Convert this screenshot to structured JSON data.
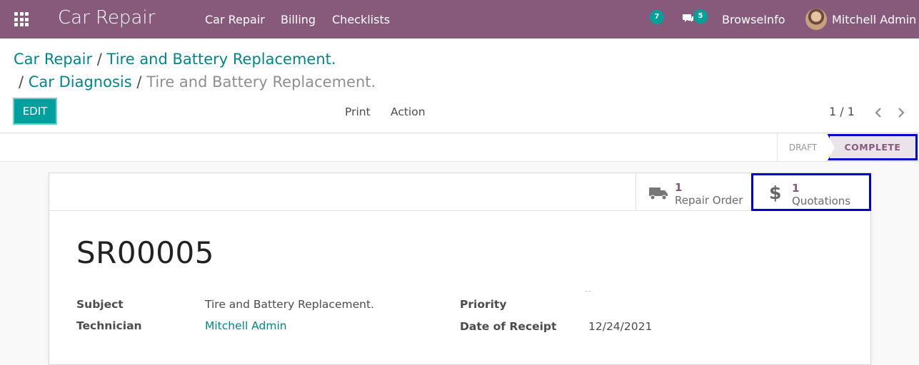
{
  "navbar": {
    "app_title": "Car Repair",
    "menu": [
      "Car Repair",
      "Billing",
      "Checklists"
    ],
    "activity_count": "7",
    "messages_count": "5",
    "company": "BrowseInfo",
    "user": "Mitchell Admin"
  },
  "breadcrumb": {
    "item1": "Car Repair",
    "sep": "/",
    "item2": "Tire and Battery Replacement.",
    "item3": "Car Diagnosis",
    "current": "Tire and Battery Replacement."
  },
  "control": {
    "edit_label": "EDIT",
    "print_label": "Print",
    "action_label": "Action",
    "pager": "1 / 1"
  },
  "status": {
    "draft": "DRAFT",
    "complete": "COMPLETE"
  },
  "smart_buttons": {
    "repair_order": {
      "count": "1",
      "label": "Repair Order"
    },
    "quotations": {
      "count": "1",
      "label": "Quotations"
    }
  },
  "record": {
    "name": "SR00005",
    "subject_label": "Subject",
    "subject": "Tire and Battery Replacement.",
    "technician_label": "Technician",
    "technician": "Mitchell Admin",
    "priority_label": "Priority",
    "date_label": "Date of Receipt",
    "date": "12/24/2021"
  },
  "icons": {
    "apps": "apps-grid-icon",
    "chat": "chat-icon",
    "truck": "truck-icon",
    "dollar": "dollar-icon",
    "prev": "chevron-left-icon",
    "next": "chevron-right-icon"
  },
  "colors": {
    "brand": "#875a7b",
    "accent": "#00a09d",
    "link": "#00868b",
    "highlight": "#0000cc"
  }
}
